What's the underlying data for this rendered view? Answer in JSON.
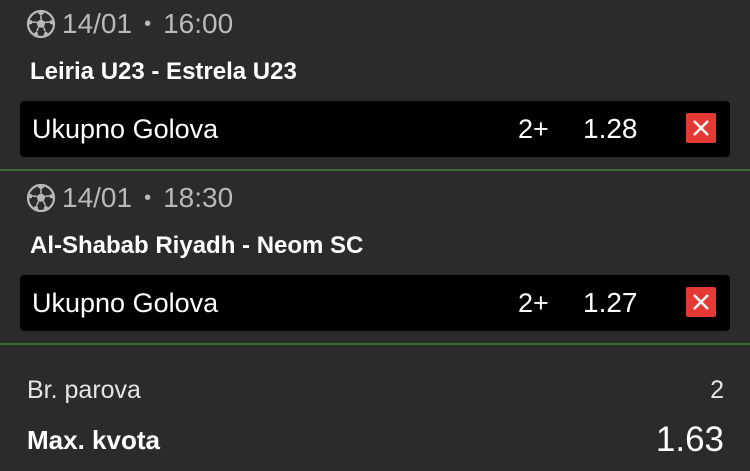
{
  "matches": [
    {
      "date": "14/01",
      "time": "16:00",
      "separator": "•",
      "teams": "Leiria U23 - Estrela U23",
      "bet": {
        "market": "Ukupno Golova",
        "pick": "2+",
        "odd": "1.28"
      }
    },
    {
      "date": "14/01",
      "time": "18:30",
      "separator": "•",
      "teams": "Al-Shabab Riyadh - Neom SC",
      "bet": {
        "market": "Ukupno Golova",
        "pick": "2+",
        "odd": "1.27"
      }
    }
  ],
  "summary": {
    "pairs_label": "Br. parova",
    "pairs_value": "2",
    "max_odds_label": "Max. kvota",
    "max_odds_value": "1.63"
  },
  "icons": {
    "sport": "soccer-ball-icon",
    "remove": "close-icon"
  },
  "colors": {
    "background": "#2b2b2b",
    "bet_row": "#000000",
    "remove_button": "#e53935",
    "divider": "#3e6b34",
    "muted_text": "#b9b9b9"
  }
}
